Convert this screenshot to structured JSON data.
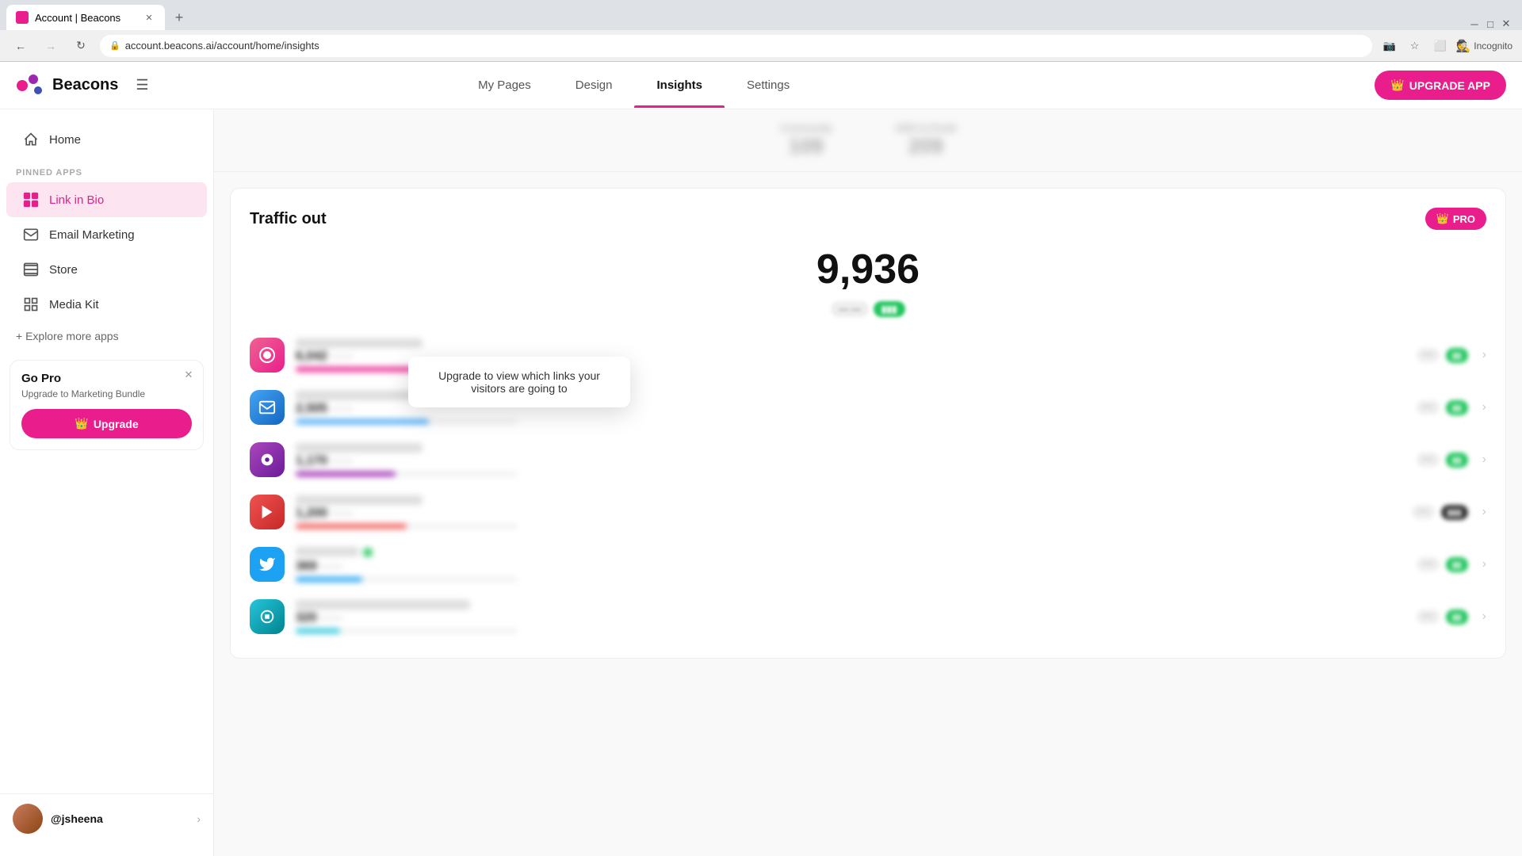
{
  "browser": {
    "tab_title": "Account | Beacons",
    "tab_favicon": "🔗",
    "url": "account.beacons.ai/account/home/insights",
    "new_tab_symbol": "+",
    "nav_back": "←",
    "nav_forward": "→",
    "nav_refresh": "↻",
    "incognito_label": "Incognito"
  },
  "top_nav": {
    "logo_text": "Beacons",
    "links": [
      {
        "label": "My Pages",
        "active": false
      },
      {
        "label": "Design",
        "active": false
      },
      {
        "label": "Insights",
        "active": true
      },
      {
        "label": "Settings",
        "active": false
      }
    ],
    "upgrade_btn": "UPGRADE APP"
  },
  "sidebar": {
    "home_label": "Home",
    "pinned_label": "PINNED APPS",
    "pinned_items": [
      {
        "label": "Link in Bio",
        "active": true
      },
      {
        "label": "Email Marketing",
        "active": false
      },
      {
        "label": "Store",
        "active": false
      },
      {
        "label": "Media Kit",
        "active": false
      }
    ],
    "explore_label": "+ Explore more apps",
    "go_pro": {
      "title": "Go Pro",
      "subtitle": "Upgrade to Marketing Bundle",
      "btn_label": "Upgrade"
    },
    "user": {
      "name": "@jsheena",
      "chevron": "›"
    }
  },
  "content": {
    "blurred_stats": [
      {
        "label": "Community",
        "value": "109"
      },
      {
        "label": "SMS & Email",
        "value": "209"
      }
    ],
    "traffic_out": {
      "section_title": "Traffic out",
      "pro_badge": "PRO",
      "total_number": "9,936",
      "total_badge_1": "---",
      "total_badge_2": "■■■",
      "tooltip_text": "Upgrade to view which links your visitors are going to",
      "items": [
        {
          "color_class": "icon-pink",
          "icon": "◎",
          "bar_color": "#e91e8c",
          "bar_width": "75"
        },
        {
          "color_class": "icon-blue",
          "icon": "✉",
          "bar_color": "#42a5f5",
          "bar_width": "60"
        },
        {
          "color_class": "icon-purple",
          "icon": "◉",
          "bar_color": "#9c27b0",
          "bar_width": "45"
        },
        {
          "color_class": "icon-red",
          "icon": "▶",
          "bar_color": "#ef5350",
          "bar_width": "50"
        },
        {
          "color_class": "icon-twitter",
          "icon": "🐦",
          "bar_color": "#1da1f2",
          "bar_width": "30"
        },
        {
          "color_class": "icon-teal",
          "icon": "◈",
          "bar_color": "#26c6da",
          "bar_width": "20"
        }
      ]
    }
  }
}
